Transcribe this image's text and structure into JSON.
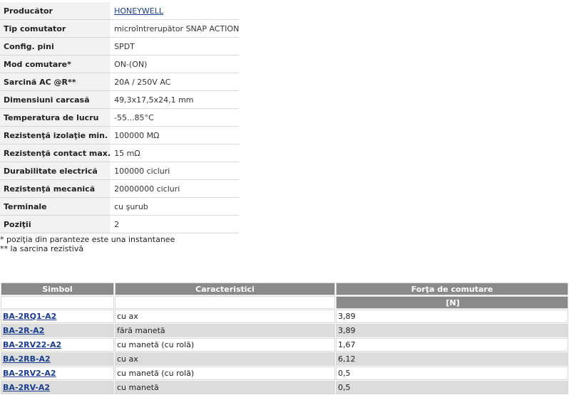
{
  "specs": [
    {
      "key": "Producător",
      "value": "HONEYWELL",
      "link": true
    },
    {
      "key": "Tip comutator",
      "value": "microîntrerupător SNAP ACTION"
    },
    {
      "key": "Config. pini",
      "value": "SPDT"
    },
    {
      "key": "Mod comutare*",
      "value": "ON-(ON)"
    },
    {
      "key": "Sarcină AC @R**",
      "value": "20A / 250V AC"
    },
    {
      "key": "Dimensiuni carcasă",
      "value": "49,3x17,5x24,1 mm"
    },
    {
      "key": "Temperatura de lucru",
      "value": "-55...85°C"
    },
    {
      "key": "Rezistenţă izolaţie min.",
      "value": "100000 MΩ"
    },
    {
      "key": "Rezistenţă contact max.",
      "value": "15 mΩ"
    },
    {
      "key": "Durabilitate electrică",
      "value": "100000 cicluri"
    },
    {
      "key": "Rezistenţă mecanică",
      "value": "20000000 cicluri"
    },
    {
      "key": "Terminale",
      "value": "cu şurub"
    },
    {
      "key": "Poziţii",
      "value": "2"
    }
  ],
  "notes": {
    "note1": "* poziţia din paranteze este una instantanee",
    "note2": "** la sarcina rezistivă"
  },
  "products": {
    "headers": {
      "symbol": "Simbol",
      "characteristics": "Caracteristici",
      "force": "Forţa de comutare",
      "force_unit": "[N]"
    },
    "rows": [
      {
        "symbol": "BA-2RQ1-A2",
        "characteristics": "cu ax",
        "force": "3,89"
      },
      {
        "symbol": "BA-2R-A2",
        "characteristics": "fără manetă",
        "force": "3,89"
      },
      {
        "symbol": "BA-2RV22-A2",
        "characteristics": "cu manetă (cu rolă)",
        "force": "1,67"
      },
      {
        "symbol": "BA-2RB-A2",
        "characteristics": "cu ax",
        "force": "6,12"
      },
      {
        "symbol": "BA-2RV2-A2",
        "characteristics": "cu manetă (cu rolă)",
        "force": "0,5"
      },
      {
        "symbol": "BA-2RV-A2",
        "characteristics": "cu manetă",
        "force": "0,5"
      }
    ]
  },
  "colors": {
    "header_bg": "#8a8a8a",
    "alt_row_bg": "#dcdcdc",
    "key_bg": "#f2f2f2",
    "link": "#1a3d8f"
  }
}
